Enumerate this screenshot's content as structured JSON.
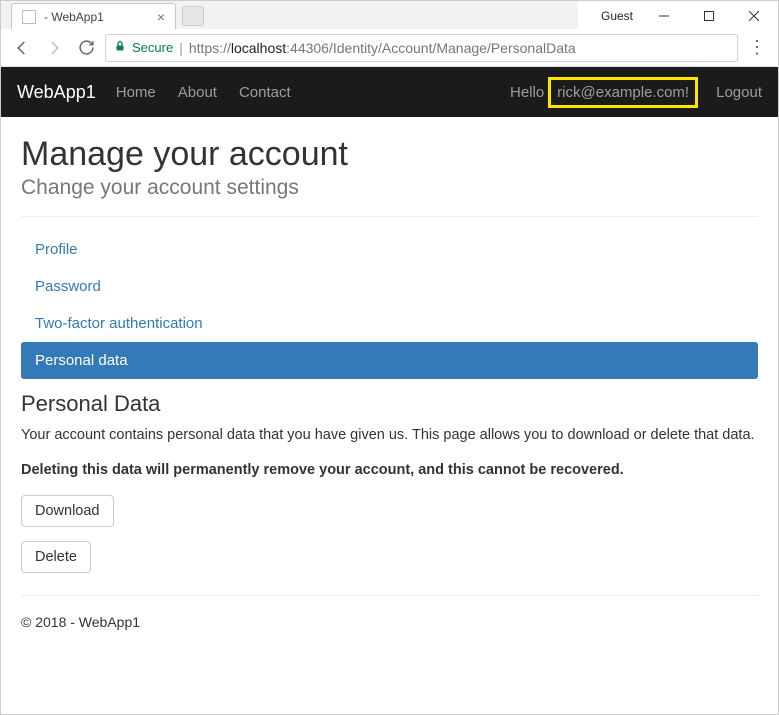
{
  "window": {
    "guest_label": "Guest"
  },
  "tab": {
    "title": " - WebApp1"
  },
  "address": {
    "secure_label": "Secure",
    "url_prefix": "https://",
    "host": "localhost",
    "port": ":44306",
    "path": "/Identity/Account/Manage/PersonalData"
  },
  "nav": {
    "brand": "WebApp1",
    "home": "Home",
    "about": "About",
    "contact": "Contact",
    "hello_prefix": "Hello ",
    "user": "rick@example.com!",
    "logout": "Logout"
  },
  "page": {
    "heading": "Manage your account",
    "subheading": "Change your account settings",
    "tabs": {
      "profile": "Profile",
      "password": "Password",
      "twofactor": "Two-factor authentication",
      "personaldata": "Personal data"
    },
    "section_title": "Personal Data",
    "desc": "Your account contains personal data that you have given us. This page allows you to download or delete that data.",
    "warning": "Deleting this data will permanently remove your account, and this cannot be recovered.",
    "download": "Download",
    "delete": "Delete"
  },
  "footer": {
    "text": "© 2018 - WebApp1"
  }
}
